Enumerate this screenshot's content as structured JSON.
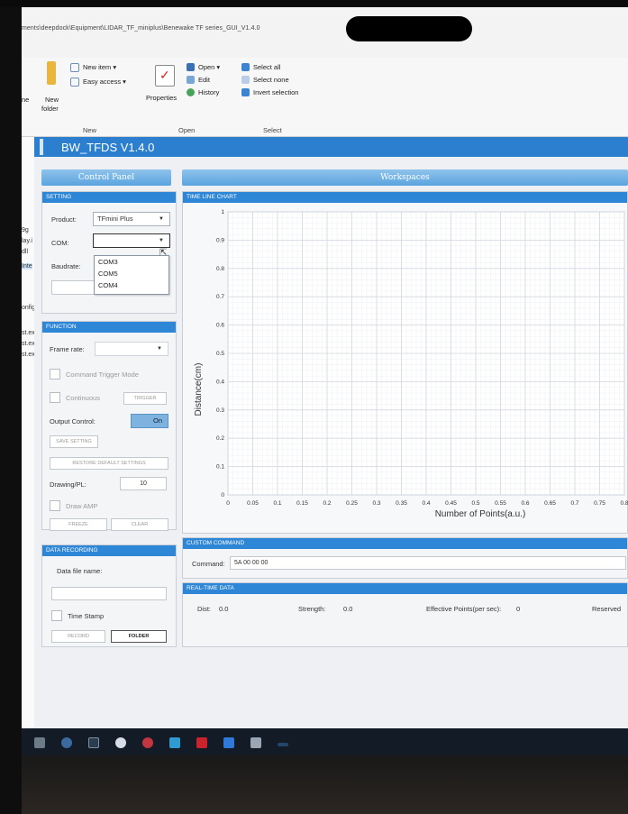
{
  "explorer": {
    "path": "ments\\deepdock\\Equipment\\LIDAR_TF_miniplus\\Benewake TF series_GUI_V1.4.0",
    "ribbon": {
      "new_item": "New item ▾",
      "easy_access": "Easy access ▾",
      "new_folder_1": "New",
      "new_folder_2": "folder",
      "properties": "Properties",
      "open": "Open ▾",
      "edit": "Edit",
      "history": "History",
      "select_all": "Select all",
      "select_none": "Select none",
      "invert_selection": "Invert selection",
      "group_new": "New",
      "group_open": "Open",
      "group_select": "Select"
    },
    "nav_fragments": [
      "9g",
      "lay.i",
      "dll",
      "Inte",
      "onfig",
      "st.exe",
      "st.exe",
      "st.exe"
    ]
  },
  "app": {
    "title": "BW_TFDS V1.4.0",
    "control_panel_title": "Control Panel",
    "workspaces_title": "Workspaces",
    "setting": {
      "header": "SETTING",
      "product_label": "Product:",
      "product_value": "TFmini Plus",
      "com_label": "COM:",
      "com_value": "",
      "baudrate_label": "Baudrate:",
      "com_options": [
        "COM3",
        "COM5",
        "COM4"
      ]
    },
    "function": {
      "header": "FUNCTION",
      "frame_rate_label": "Frame rate:",
      "command_trigger_mode": "Command Trigger Mode",
      "continuous": "Continuous",
      "trigger": "TRIGGER",
      "output_control_label": "Output Control:",
      "output_control_state": "On",
      "save_setting": "SAVE SETTING",
      "restore_default": "RESTORE DEFAULT SETTINGS",
      "drawing_pl_label": "Drawing/PL:",
      "drawing_pl_value": "10",
      "draw_amp": "Draw AMP",
      "freeze": "FREEZE",
      "clear": "CLEAR"
    },
    "data_recording": {
      "header": "DATA RECORDING",
      "data_file_name_label": "Data file name:",
      "data_file_name_value": "",
      "time_stamp": "Time Stamp",
      "record": "RECORD",
      "folder": "FOLDER"
    },
    "timeline": {
      "header": "TIME LINE CHART"
    },
    "custom_command": {
      "header": "CUSTOM COMMAND",
      "command_label": "Command:",
      "command_value": "5A 00 00 00"
    },
    "realtime": {
      "header": "REAL-TIME DATA",
      "dist_label": "Dist:",
      "dist_value": "0.0",
      "strength_label": "Strength:",
      "strength_value": "0.0",
      "effective_label": "Effective Points(per sec):",
      "effective_value": "0",
      "reserved_label": "Reserved"
    }
  },
  "chart_data": {
    "type": "line",
    "title": "",
    "xlabel": "Number of Points(a.u.)",
    "ylabel": "Distance(cm)",
    "xlim": [
      0,
      0.8
    ],
    "ylim": [
      0,
      1
    ],
    "x_ticks": [
      "0",
      "0.05",
      "0.1",
      "0.15",
      "0.2",
      "0.25",
      "0.3",
      "0.35",
      "0.4",
      "0.45",
      "0.5",
      "0.55",
      "0.6",
      "0.65",
      "0.7",
      "0.75",
      "0.8"
    ],
    "y_ticks": [
      "0",
      "0.1",
      "0.2",
      "0.3",
      "0.4",
      "0.5",
      "0.6",
      "0.7",
      "0.8",
      "0.9",
      "1"
    ],
    "grid": true,
    "series": []
  }
}
